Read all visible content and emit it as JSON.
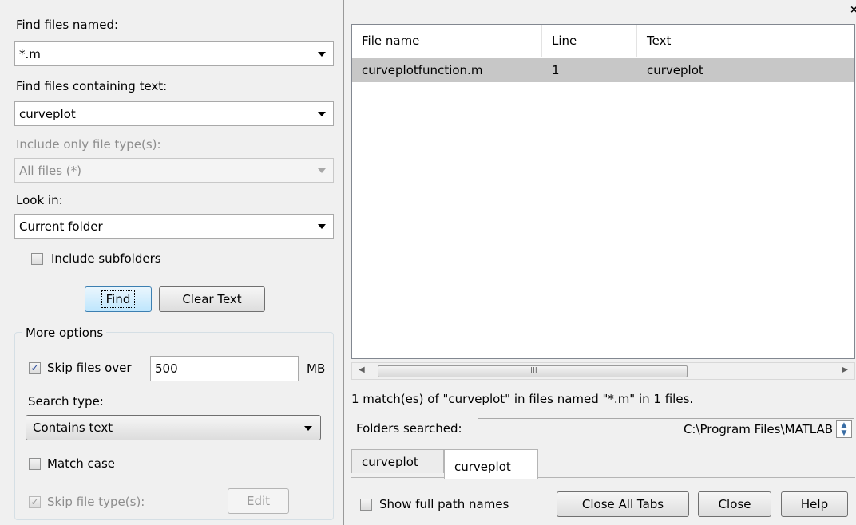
{
  "left": {
    "find_named_label": "Find files named:",
    "find_named_value": "*.m",
    "containing_label": "Find files containing text:",
    "containing_value": "curveplot",
    "file_types_label": "Include only file type(s):",
    "file_types_value": "All files (*)",
    "look_in_label": "Look in:",
    "look_in_value": "Current folder",
    "include_subfolders_label": "Include subfolders",
    "include_subfolders_checked": false,
    "find_button": "Find",
    "clear_text_button": "Clear Text",
    "more_options": {
      "legend": "More options",
      "skip_over_label": "Skip files over",
      "skip_over_checked": true,
      "skip_over_value": "500",
      "skip_over_unit": "MB",
      "search_type_label": "Search type:",
      "search_type_value": "Contains text",
      "match_case_label": "Match case",
      "match_case_checked": false,
      "skip_types_label": "Skip file type(s):",
      "skip_types_checked": true,
      "edit_button": "Edit"
    }
  },
  "results": {
    "columns": [
      "File name",
      "Line",
      "Text"
    ],
    "rows": [
      {
        "file": "curveplotfunction.m",
        "line": "1",
        "text": "curveplot"
      }
    ],
    "summary": "1 match(es) of \"curveplot\" in files named \"*.m\" in 1 files.",
    "folders_label": "Folders searched:",
    "folders_value": "C:\\Program Files\\MATLAB",
    "scroll_middle_glyph": "III"
  },
  "tabs": [
    {
      "label": "curveplot",
      "active": false
    },
    {
      "label": "curveplot",
      "active": true
    }
  ],
  "footer": {
    "show_full_paths_label": "Show full path names",
    "show_full_paths_checked": false,
    "close_all_tabs": "Close All Tabs",
    "close": "Close",
    "help": "Help"
  },
  "window_close_glyph": "×"
}
